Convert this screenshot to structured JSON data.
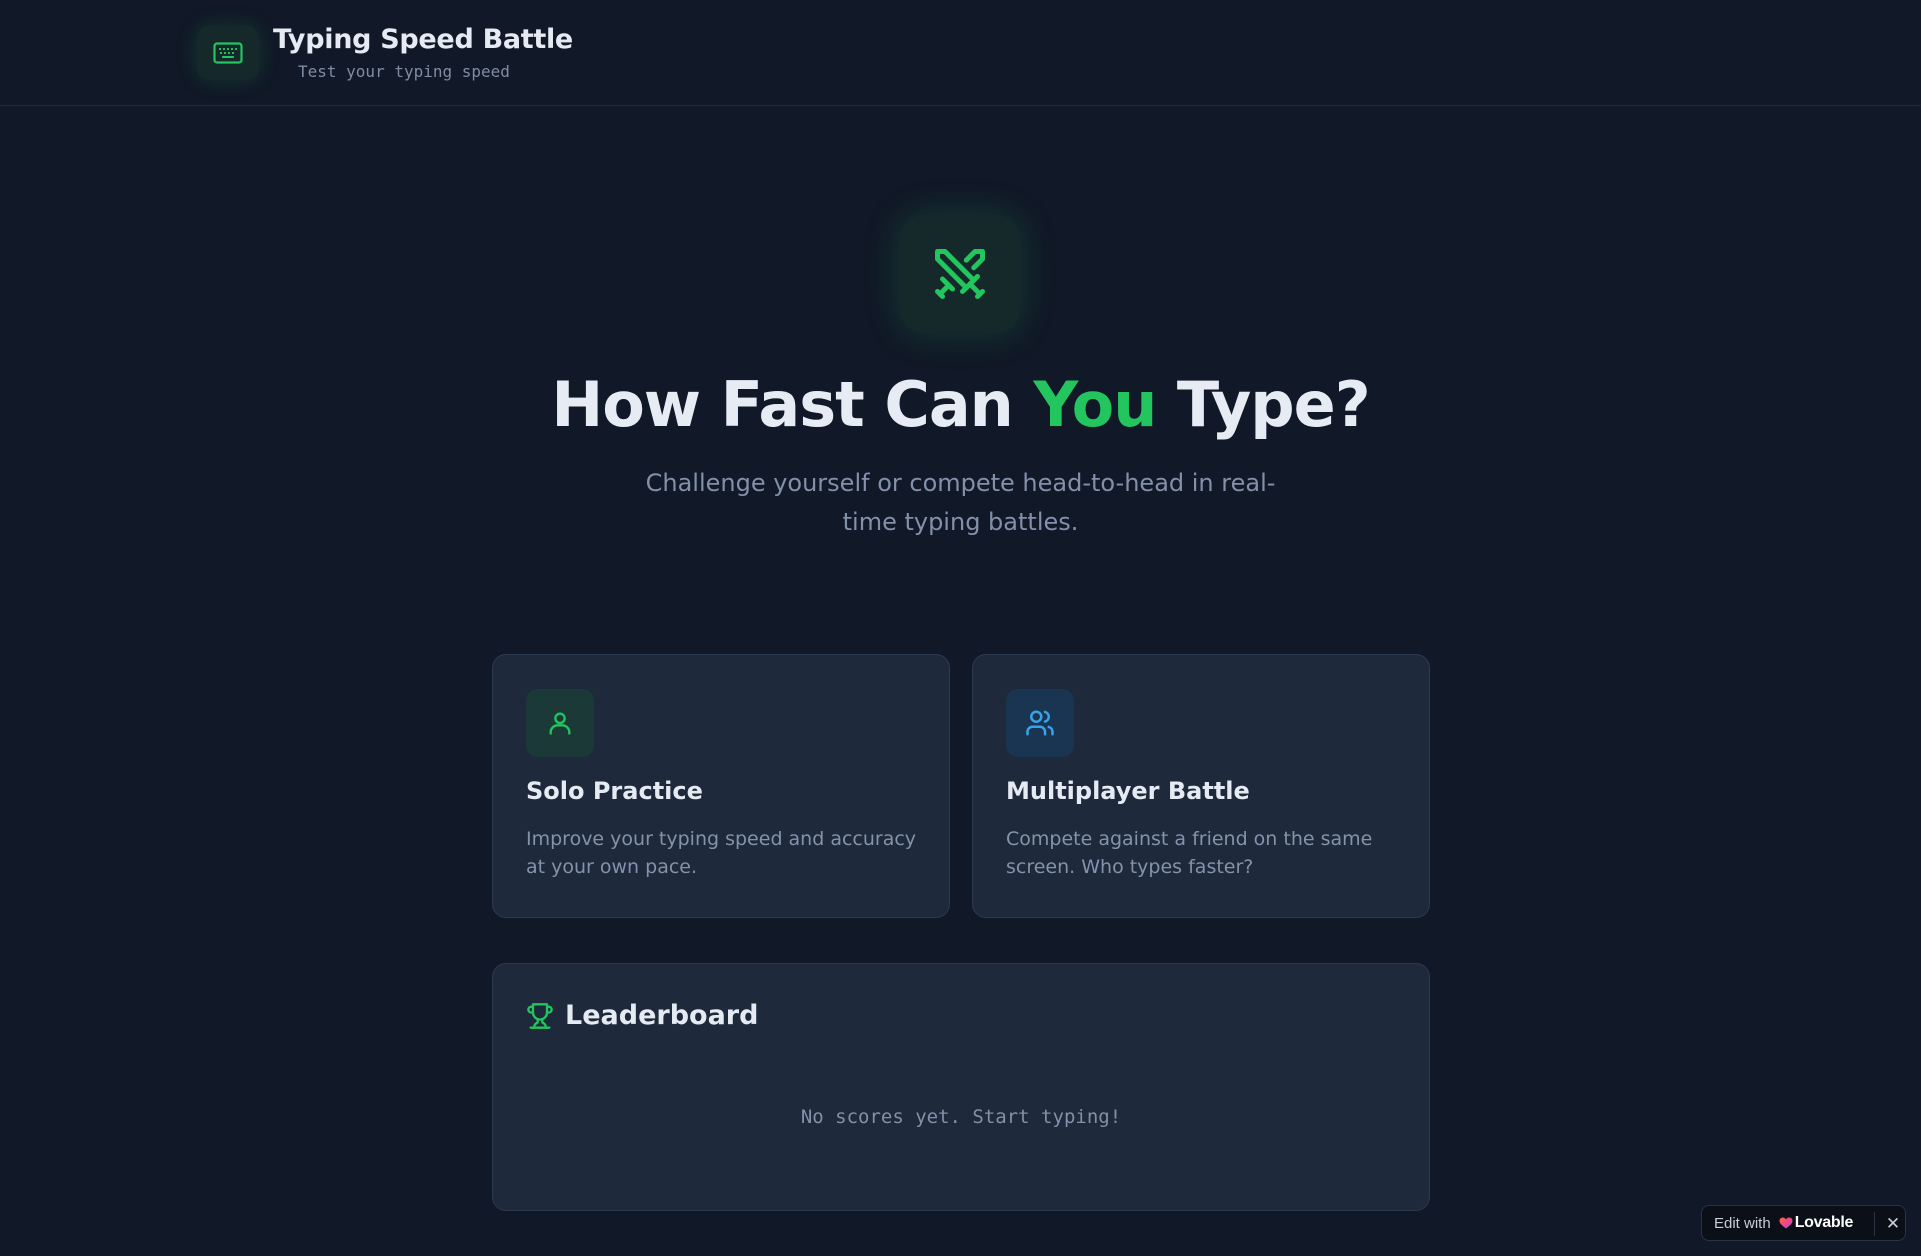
{
  "header": {
    "title": "Typing Speed Battle",
    "subtitle": "Test your typing speed",
    "logo_icon": "keyboard-icon"
  },
  "hero": {
    "icon": "crossed-swords-icon",
    "title_before": "How Fast Can ",
    "title_accent": "You",
    "title_after": " Type?",
    "subtitle": "Challenge yourself or compete head-to-head in real-time typing battles."
  },
  "modes": [
    {
      "icon": "user-icon",
      "title": "Solo Practice",
      "description": "Improve your typing speed and accuracy at your own pace."
    },
    {
      "icon": "users-icon",
      "title": "Multiplayer Battle",
      "description": "Compete against a friend on the same screen. Who types faster?"
    }
  ],
  "leaderboard": {
    "icon": "trophy-icon",
    "title": "Leaderboard",
    "empty_message": "No scores yet. Start typing!"
  },
  "edit_badge": {
    "label": "Edit with",
    "brand": "Lovable",
    "close": "✕"
  },
  "colors": {
    "background": "#111827",
    "card": "#1e293b",
    "accent_green": "#22c55e",
    "accent_blue": "#38a3e8",
    "text_primary": "#e6ebf3",
    "text_muted": "#8290aa"
  }
}
